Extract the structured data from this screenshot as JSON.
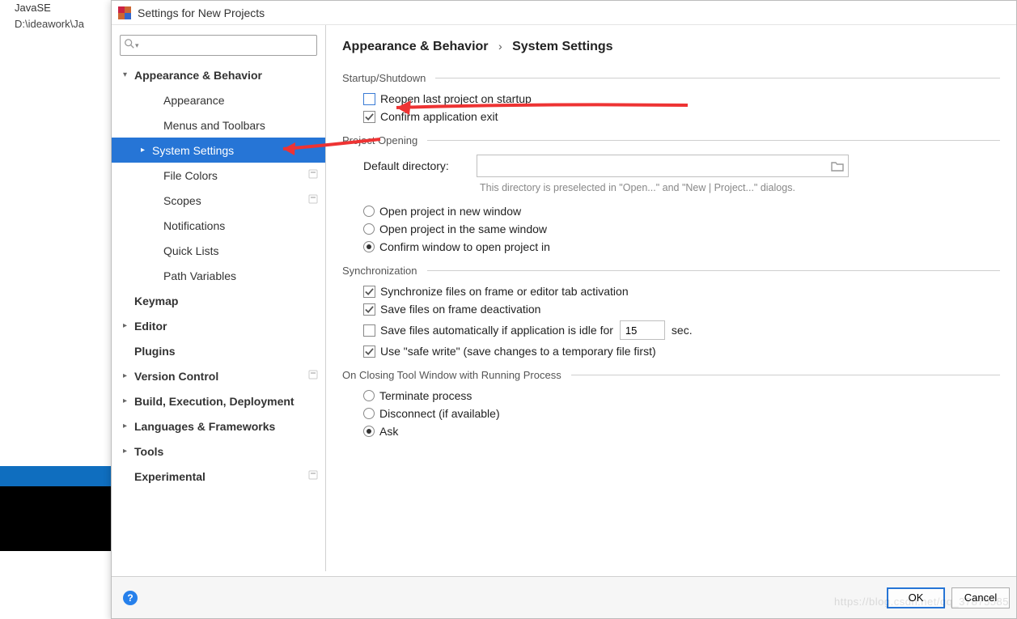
{
  "background": {
    "project_name": "JavaSE",
    "project_path": "D:\\ideawork\\Ja"
  },
  "window": {
    "title": "Settings for New Projects",
    "search_placeholder": ""
  },
  "sidebar": {
    "items": [
      {
        "label": "Appearance & Behavior",
        "bold": true,
        "arrow": "v",
        "lvl": 0
      },
      {
        "label": "Appearance",
        "lvl": 1
      },
      {
        "label": "Menus and Toolbars",
        "lvl": 1
      },
      {
        "label": "System Settings",
        "lvl": "1h",
        "arrow": ">",
        "selected": true
      },
      {
        "label": "File Colors",
        "lvl": 1,
        "badge": true
      },
      {
        "label": "Scopes",
        "lvl": 1,
        "badge": true
      },
      {
        "label": "Notifications",
        "lvl": 1
      },
      {
        "label": "Quick Lists",
        "lvl": 1
      },
      {
        "label": "Path Variables",
        "lvl": 1
      },
      {
        "label": "Keymap",
        "bold": true,
        "lvl": 0,
        "pad": true
      },
      {
        "label": "Editor",
        "bold": true,
        "arrow": ">",
        "lvl": 0
      },
      {
        "label": "Plugins",
        "bold": true,
        "lvl": 0,
        "pad": true
      },
      {
        "label": "Version Control",
        "bold": true,
        "arrow": ">",
        "lvl": 0,
        "badge": true
      },
      {
        "label": "Build, Execution, Deployment",
        "bold": true,
        "arrow": ">",
        "lvl": 0
      },
      {
        "label": "Languages & Frameworks",
        "bold": true,
        "arrow": ">",
        "lvl": 0
      },
      {
        "label": "Tools",
        "bold": true,
        "arrow": ">",
        "lvl": 0
      },
      {
        "label": "Experimental",
        "bold": true,
        "lvl": 0,
        "pad": true,
        "badge": true
      }
    ]
  },
  "breadcrumb": {
    "root": "Appearance & Behavior",
    "leaf": "System Settings"
  },
  "sections": {
    "startup": {
      "title": "Startup/Shutdown",
      "reopen": {
        "label": "Reopen last project on startup",
        "checked": false
      },
      "confirm_exit": {
        "label": "Confirm application exit",
        "checked": true
      }
    },
    "opening": {
      "title": "Project Opening",
      "default_dir_label": "Default directory:",
      "default_dir_value": "",
      "hint": "This directory is preselected in \"Open...\" and \"New | Project...\" dialogs.",
      "radios": [
        {
          "label": "Open project in new window",
          "sel": false
        },
        {
          "label": "Open project in the same window",
          "sel": false
        },
        {
          "label": "Confirm window to open project in",
          "sel": true
        }
      ]
    },
    "sync": {
      "title": "Synchronization",
      "sync_on_activate": {
        "label": "Synchronize files on frame or editor tab activation",
        "checked": true
      },
      "save_on_deact": {
        "label": "Save files on frame deactivation",
        "checked": true
      },
      "save_idle": {
        "label": "Save files automatically if application is idle for",
        "checked": false,
        "value": "15",
        "suffix": "sec."
      },
      "safe_write": {
        "label": "Use \"safe write\" (save changes to a temporary file first)",
        "checked": true
      }
    },
    "closing": {
      "title": "On Closing Tool Window with Running Process",
      "radios": [
        {
          "label": "Terminate process",
          "sel": false
        },
        {
          "label": "Disconnect (if available)",
          "sel": false
        },
        {
          "label": "Ask",
          "sel": true
        }
      ]
    }
  },
  "buttons": {
    "ok": "OK",
    "cancel": "Cancel"
  },
  "watermark": "https://blog.csdn.net/qq_37875585"
}
